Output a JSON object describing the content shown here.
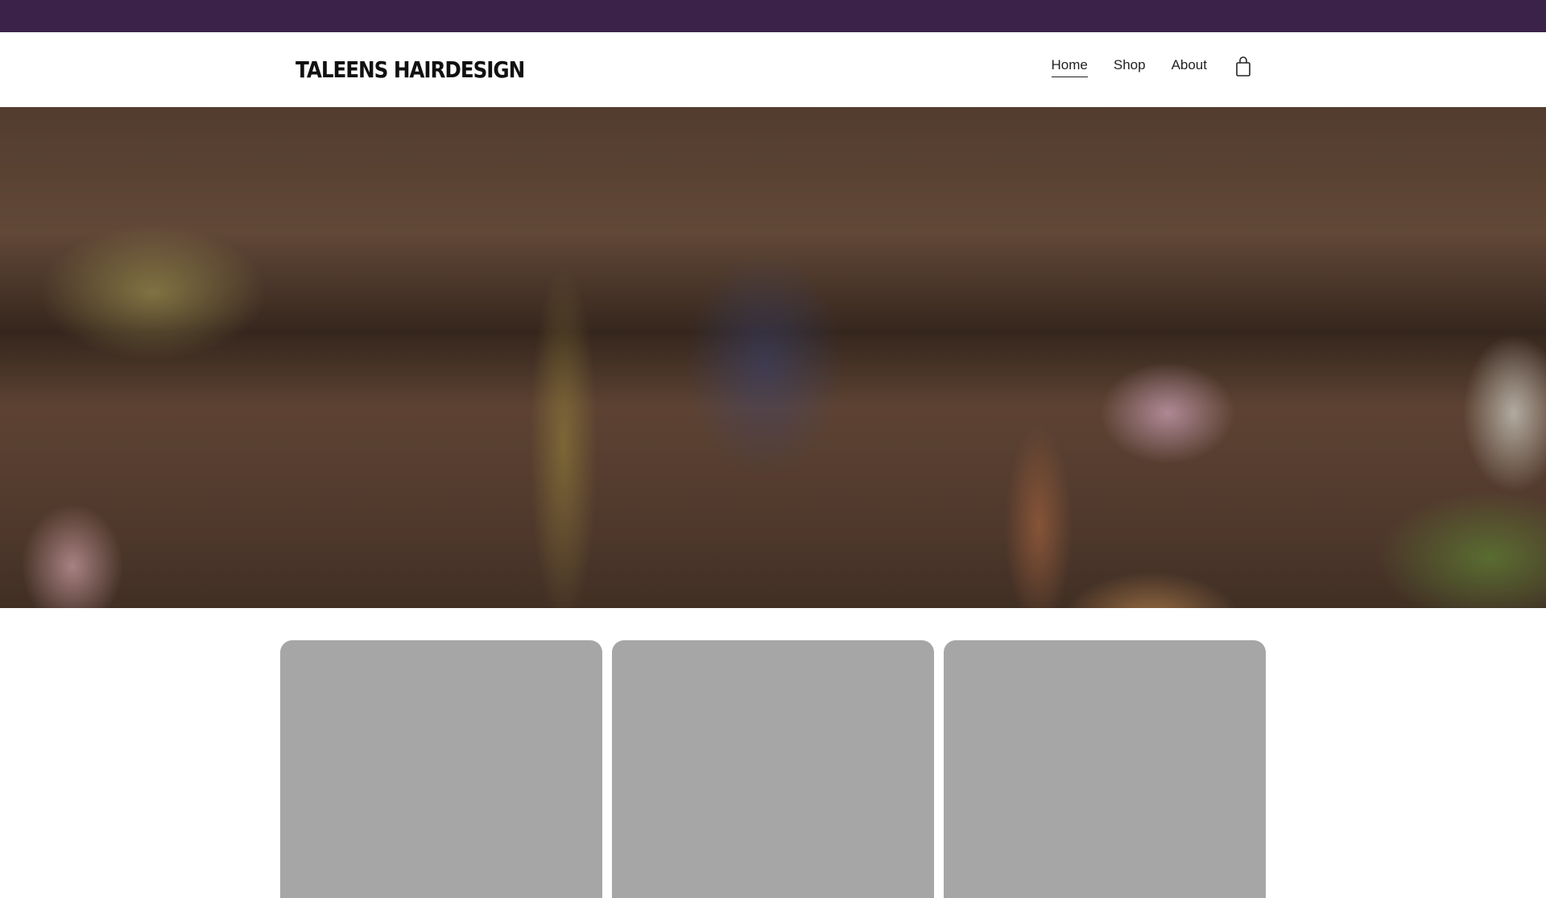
{
  "header": {
    "logo": "TALEENS HAIRDESIGN",
    "nav": [
      {
        "label": "Home",
        "active": true
      },
      {
        "label": "Shop",
        "active": false
      },
      {
        "label": "About",
        "active": false
      }
    ],
    "cart_icon": "shopping-bag-icon"
  },
  "colors": {
    "topbar": "#3b2249",
    "card": "#a6a6a6"
  }
}
